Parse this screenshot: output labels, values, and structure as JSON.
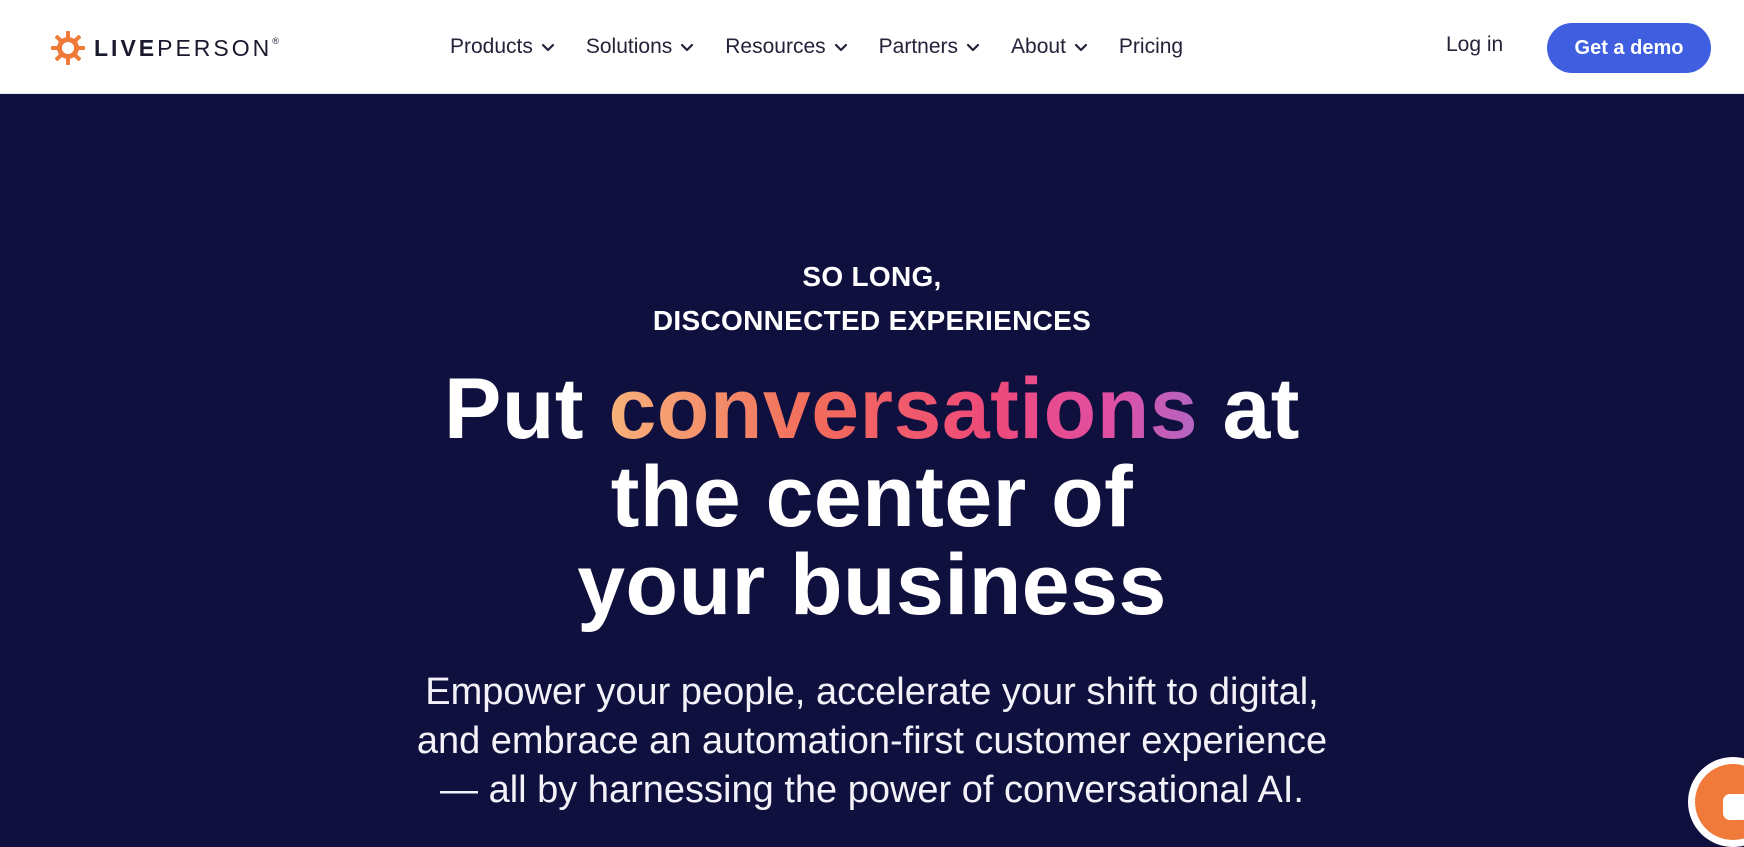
{
  "brand": {
    "logo_icon": "liveperson-sun-icon",
    "name_bold": "LIVE",
    "name_light": "PERSON",
    "registered": "®",
    "accent_color": "#f07a3a"
  },
  "nav": {
    "items": [
      {
        "label": "Products",
        "has_dropdown": true
      },
      {
        "label": "Solutions",
        "has_dropdown": true
      },
      {
        "label": "Resources",
        "has_dropdown": true
      },
      {
        "label": "Partners",
        "has_dropdown": true
      },
      {
        "label": "About",
        "has_dropdown": true
      },
      {
        "label": "Pricing",
        "has_dropdown": false
      }
    ],
    "login_label": "Log in",
    "demo_label": "Get a demo",
    "demo_color": "#3f5fe0"
  },
  "hero": {
    "background_color": "#10103f",
    "eyebrow_line1": "SO LONG,",
    "eyebrow_line2": "DISCONNECTED EXPERIENCES",
    "headline_part1": "Put ",
    "headline_highlight": "conversations",
    "headline_part2": " at",
    "headline_line2": "the center of",
    "headline_line3": "your business",
    "subtext_line1": "Empower your people, accelerate your shift to digital,",
    "subtext_line2": "and embrace an automation-first customer experience",
    "subtext_line3": "— all by harnessing the power of conversational AI."
  },
  "chat_widget": {
    "icon": "chat-bubble-icon"
  }
}
